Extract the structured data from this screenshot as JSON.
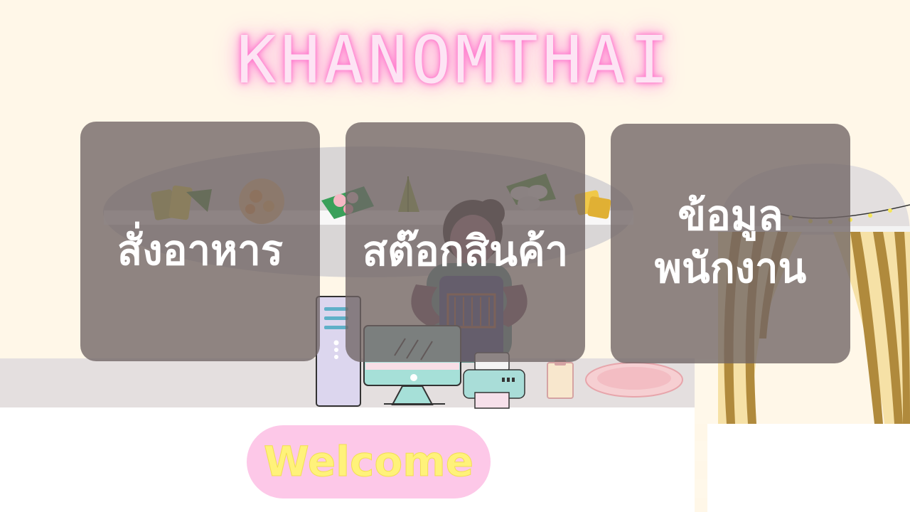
{
  "title": "KHANOMTHAI",
  "menu": [
    {
      "label": "สั่งอาหาร"
    },
    {
      "label": "สต๊อกสินค้า"
    },
    {
      "label_line1": "ข้อมูล",
      "label_line2": "พนักงาน"
    }
  ],
  "welcome_button": {
    "label": "Welcome"
  },
  "colors": {
    "title_glow": "#ff6ec9",
    "panel_bg": "#706464",
    "welcome_bg": "#fdc8e8",
    "welcome_text": "#fff27a"
  },
  "icons": [
    "thai-dessert-icon",
    "baker-illustration",
    "computer-icon",
    "printer-icon",
    "curtain-icon",
    "string-lights-icon"
  ]
}
